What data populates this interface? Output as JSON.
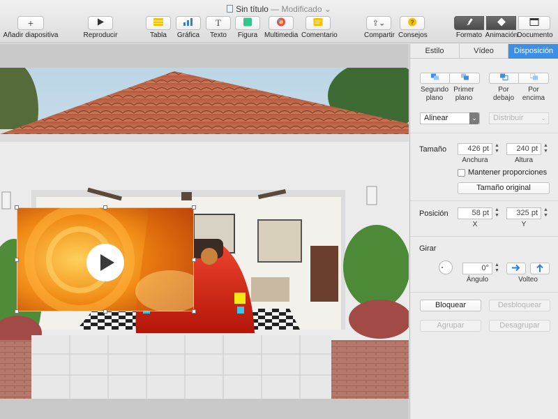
{
  "window": {
    "title": "Sin título",
    "separator": "—",
    "status": "Modificado"
  },
  "toolbar": {
    "add_slide": "Añadir diapositiva",
    "play": "Reproducir",
    "table": "Tabla",
    "chart": "Gráfica",
    "text": "Texto",
    "shape": "Figura",
    "media": "Multimedia",
    "comment": "Comentario",
    "share": "Compartir",
    "tips": "Consejos",
    "format": "Formato",
    "animation": "Animación",
    "document": "Documento"
  },
  "inspector": {
    "tabs": [
      "Estilo",
      "Vídeo",
      "Disposición"
    ],
    "active_tab": "Disposición",
    "arrange": {
      "back_label": "Segundo\nplano",
      "front_label": "Primer\nplano",
      "backward_label": "Por\ndebajo",
      "forward_label": "Por\nencima"
    },
    "align": "Alinear",
    "distribute": "Distribuir",
    "size": {
      "label": "Tamaño",
      "width": "426 pt",
      "height": "240 pt",
      "width_label": "Anchura",
      "height_label": "Altura",
      "constrain": "Mantener proporciones",
      "original": "Tamaño original"
    },
    "position": {
      "label": "Posición",
      "x": "58 pt",
      "y": "325 pt",
      "x_label": "X",
      "y_label": "Y"
    },
    "rotate": {
      "label": "Girar",
      "angle": "0°",
      "angle_label": "Ángulo",
      "flip_label": "Volteo"
    },
    "lock": "Bloquear",
    "unlock": "Desbloquear",
    "group": "Agrupar",
    "ungroup": "Desagrupar"
  },
  "colors": {
    "accent": "#3d8fe6",
    "video_orange": "#e98a1a",
    "car_red": "#d8261a"
  }
}
